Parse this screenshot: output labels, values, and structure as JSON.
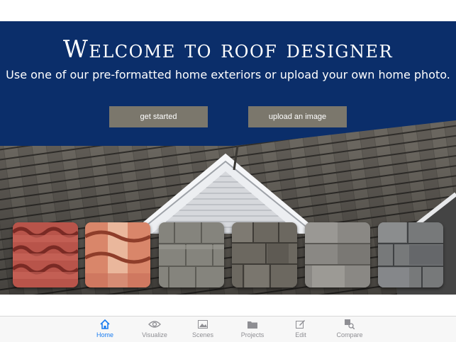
{
  "hero": {
    "title": "Welcome to roof designer",
    "subtitle": "Use one of our pre-formatted home exteriors or upload your own home photo.",
    "buttons": {
      "get_started": "get started",
      "upload": "upload an image"
    }
  },
  "swatches": [
    {
      "icon": "red-clay-tile-swatch",
      "color": "#b8544a"
    },
    {
      "icon": "terracotta-tile-swatch",
      "color": "#d9866a"
    },
    {
      "icon": "gray-wood-shake-swatch",
      "color": "#85847d"
    },
    {
      "icon": "brown-gray-shake-swatch",
      "color": "#6c6860"
    },
    {
      "icon": "gray-shingle-swatch",
      "color": "#8a8884"
    },
    {
      "icon": "dark-gray-slate-swatch",
      "color": "#77797a"
    }
  ],
  "tabbar": {
    "active": "Home",
    "accent": "#1a7cf0",
    "items": [
      {
        "label": "Home",
        "icon": "home-icon"
      },
      {
        "label": "Visualize",
        "icon": "eye-icon"
      },
      {
        "label": "Scenes",
        "icon": "image-icon"
      },
      {
        "label": "Projects",
        "icon": "folder-icon"
      },
      {
        "label": "Edit",
        "icon": "pencil-icon"
      },
      {
        "label": "Compare",
        "icon": "compare-icon"
      }
    ]
  },
  "colors": {
    "hero_background": "#0b2e6a",
    "button": "#7b776c"
  }
}
